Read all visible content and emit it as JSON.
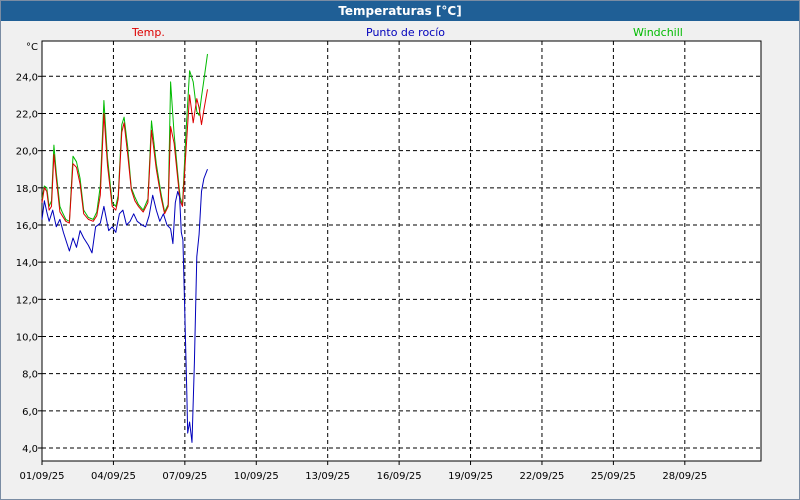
{
  "window": {
    "title": "Temperaturas [°C]"
  },
  "colors": {
    "temp": "#dd0000",
    "dew": "#0000bb",
    "windchill": "#00bb00",
    "grid": "#000000",
    "plot_bg": "#ffffff",
    "title_bg": "#1f5f96"
  },
  "chart_data": {
    "type": "line",
    "title": "Temperaturas [°C]",
    "yunit": "°C",
    "ylim": [
      3.3,
      25.9
    ],
    "yticks": [
      "4,0",
      "6,0",
      "8,0",
      "10,0",
      "12,0",
      "14,0",
      "16,0",
      "18,0",
      "20,0",
      "22,0",
      "24,0"
    ],
    "ytick_values": [
      4,
      6,
      8,
      10,
      12,
      14,
      16,
      18,
      20,
      22,
      24
    ],
    "xlim": [
      0,
      30.2
    ],
    "xticks": [
      "01/09/25",
      "04/09/25",
      "07/09/25",
      "10/09/25",
      "13/09/25",
      "16/09/25",
      "19/09/25",
      "22/09/25",
      "25/09/25",
      "28/09/25"
    ],
    "xtick_values": [
      0,
      3,
      6,
      9,
      12,
      15,
      18,
      21,
      24,
      27
    ],
    "grid": true,
    "legend_position": "top",
    "series": [
      {
        "name": "Temp.",
        "color": "#dd0000",
        "x": [
          0,
          0.1,
          0.2,
          0.3,
          0.4,
          0.5,
          0.6,
          0.75,
          0.85,
          1.0,
          1.15,
          1.3,
          1.45,
          1.6,
          1.75,
          1.95,
          2.15,
          2.3,
          2.45,
          2.6,
          2.75,
          2.95,
          3.1,
          3.2,
          3.35,
          3.45,
          3.6,
          3.75,
          3.9,
          4.05,
          4.25,
          4.45,
          4.6,
          4.8,
          5.0,
          5.15,
          5.3,
          5.4,
          5.55,
          5.7,
          5.8,
          5.9,
          6.05,
          6.2,
          6.35,
          6.5,
          6.6,
          6.7,
          6.8,
          6.95
        ],
        "y": [
          17.2,
          18.0,
          17.8,
          16.8,
          17.0,
          19.8,
          18.5,
          16.7,
          16.5,
          16.2,
          16.1,
          19.3,
          19.1,
          18.2,
          16.6,
          16.3,
          16.2,
          16.5,
          17.6,
          22.0,
          19.2,
          17.0,
          16.8,
          17.4,
          21.0,
          21.5,
          19.8,
          17.9,
          17.3,
          17.0,
          16.7,
          17.2,
          21.1,
          19.0,
          17.5,
          16.6,
          17.0,
          21.3,
          20.4,
          18.5,
          17.3,
          17.0,
          20.0,
          23.0,
          21.5,
          22.8,
          22.3,
          21.4,
          22.2,
          23.3
        ]
      },
      {
        "name": "Punto de rocío",
        "color": "#0000bb",
        "x": [
          0,
          0.1,
          0.2,
          0.3,
          0.45,
          0.6,
          0.75,
          0.9,
          1.05,
          1.15,
          1.3,
          1.45,
          1.6,
          1.75,
          1.95,
          2.1,
          2.25,
          2.45,
          2.6,
          2.8,
          2.95,
          3.1,
          3.25,
          3.4,
          3.55,
          3.7,
          3.85,
          4.0,
          4.2,
          4.35,
          4.5,
          4.65,
          4.8,
          4.95,
          5.1,
          5.25,
          5.4,
          5.5,
          5.6,
          5.7,
          5.78,
          5.85,
          5.92,
          6.0,
          6.08,
          6.12,
          6.2,
          6.3,
          6.4,
          6.5,
          6.6,
          6.7,
          6.8,
          6.95
        ],
        "y": [
          16.3,
          17.3,
          16.7,
          16.2,
          16.8,
          15.9,
          16.3,
          15.6,
          15.0,
          14.6,
          15.3,
          14.8,
          15.7,
          15.3,
          14.9,
          14.5,
          15.9,
          16.1,
          17.0,
          15.7,
          15.9,
          15.6,
          16.6,
          16.8,
          16.0,
          16.2,
          16.6,
          16.2,
          16.0,
          15.9,
          16.5,
          17.6,
          16.8,
          16.2,
          16.6,
          16.0,
          15.8,
          15.0,
          17.2,
          17.8,
          17.5,
          15.6,
          15.2,
          11.3,
          7.0,
          4.8,
          5.4,
          4.3,
          8.6,
          14.3,
          15.5,
          17.8,
          18.5,
          19.0
        ]
      },
      {
        "name": "Windchill",
        "color": "#00bb00",
        "x": [
          0,
          0.1,
          0.2,
          0.3,
          0.4,
          0.5,
          0.6,
          0.75,
          0.85,
          1.0,
          1.15,
          1.3,
          1.45,
          1.6,
          1.75,
          1.95,
          2.15,
          2.3,
          2.45,
          2.6,
          2.75,
          2.95,
          3.1,
          3.2,
          3.35,
          3.45,
          3.6,
          3.75,
          3.9,
          4.05,
          4.25,
          4.45,
          4.6,
          4.8,
          5.0,
          5.15,
          5.3,
          5.4,
          5.55,
          5.7,
          5.8,
          5.9,
          6.05,
          6.2,
          6.35,
          6.5,
          6.6,
          6.7,
          6.8,
          6.95
        ],
        "y": [
          17.4,
          18.1,
          18.0,
          17.0,
          17.3,
          20.3,
          18.8,
          17.0,
          16.7,
          16.3,
          16.2,
          19.7,
          19.4,
          18.5,
          16.8,
          16.4,
          16.3,
          16.7,
          18.1,
          22.7,
          19.6,
          17.2,
          17.0,
          17.6,
          21.4,
          21.8,
          20.2,
          18.0,
          17.5,
          17.1,
          16.8,
          17.4,
          21.6,
          19.3,
          17.7,
          16.7,
          17.1,
          23.7,
          20.9,
          18.8,
          17.5,
          17.1,
          21.0,
          24.3,
          23.7,
          22.1,
          21.9,
          22.9,
          23.8,
          25.2
        ]
      }
    ]
  }
}
